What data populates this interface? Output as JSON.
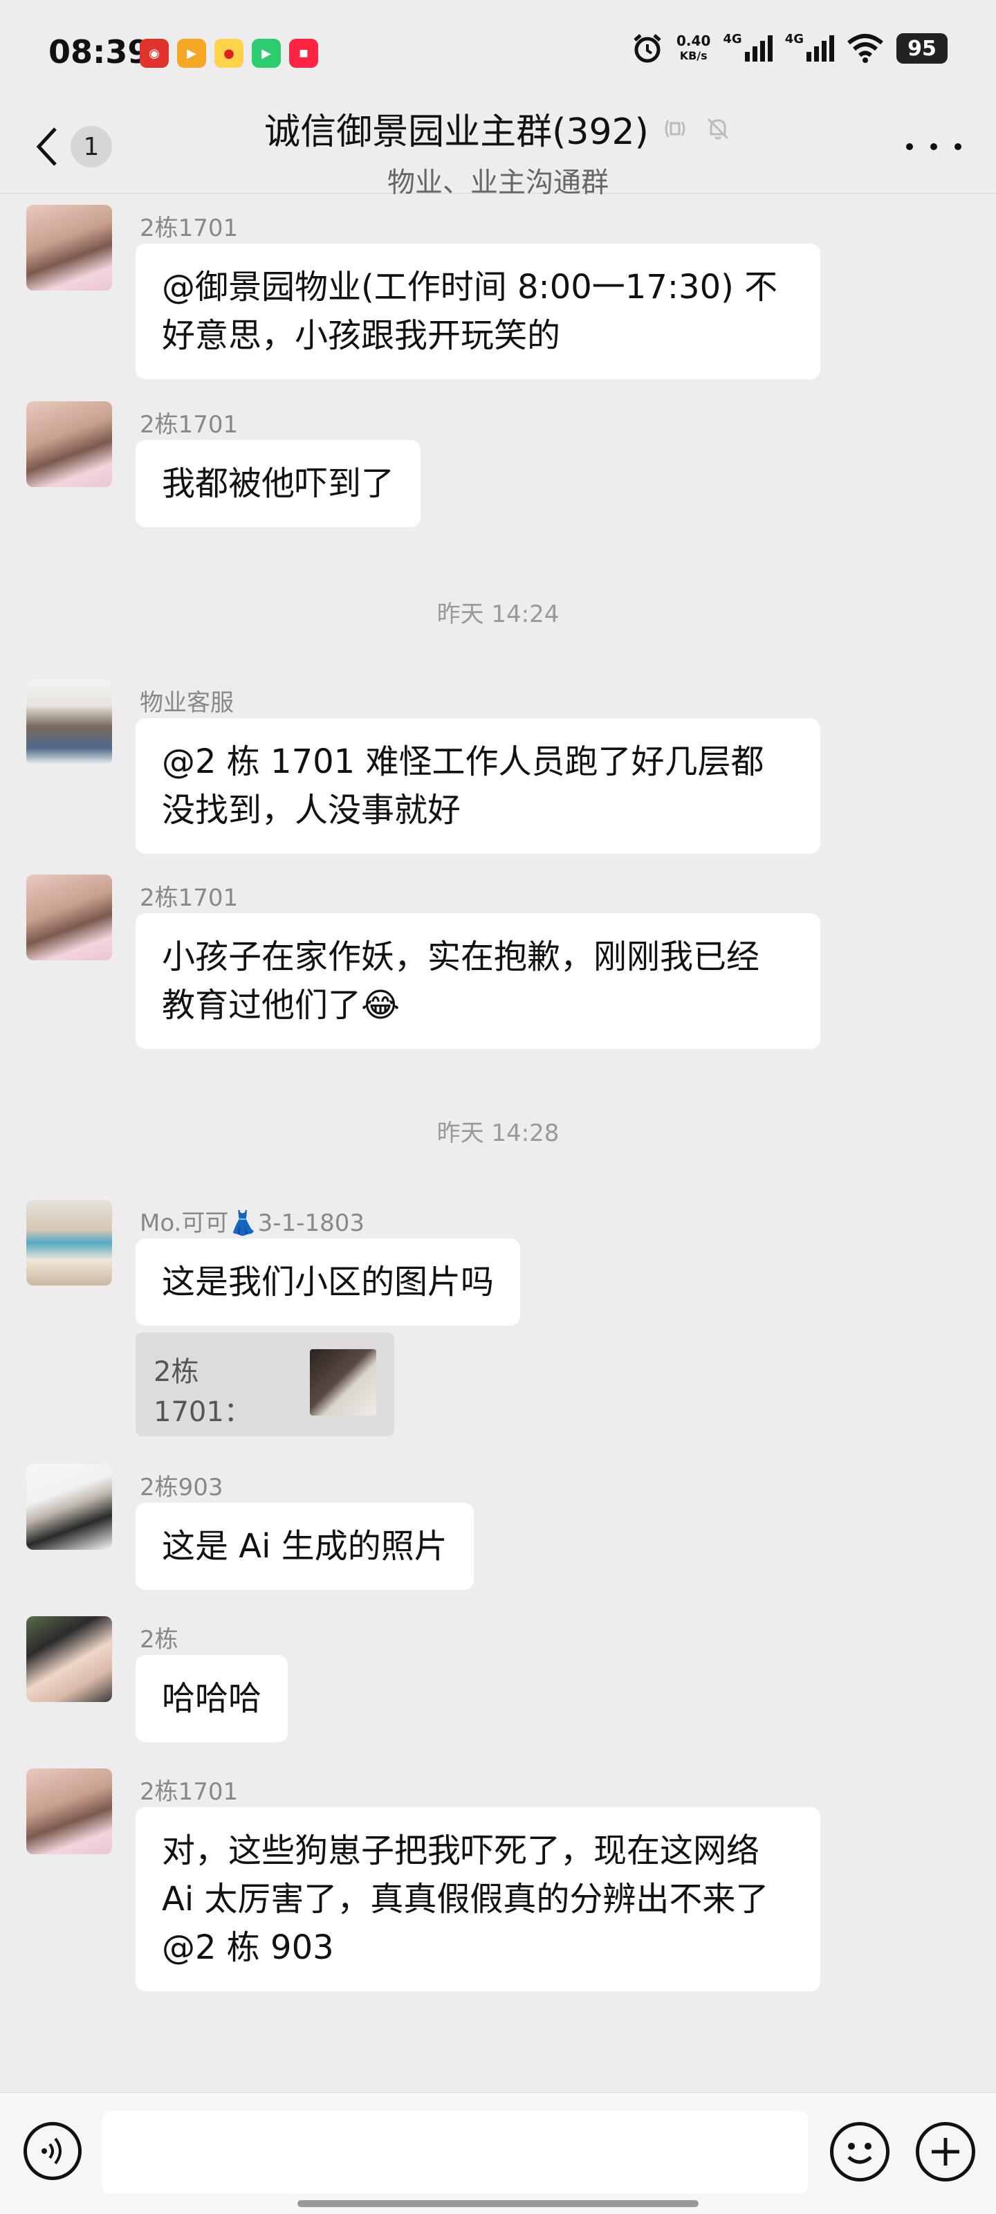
{
  "status_bar": {
    "time": "08:39",
    "net_speed_value": "0.40",
    "net_speed_unit": "KB/s",
    "signal_label": "4G",
    "battery": "95"
  },
  "header": {
    "back_count": "1",
    "title": "诚信御景园业主群(392)",
    "subtitle": "物业、业主沟通群"
  },
  "messages": [
    {
      "sender": "2栋1701",
      "lines": [
        "@御景园物业(工作时间 8:00一17:30) 不",
        "好意思，小孩跟我开玩笑的"
      ]
    },
    {
      "sender": "2栋1701",
      "lines": [
        "我都被他吓到了"
      ]
    },
    {
      "sender": "物业客服",
      "lines": [
        "@2 栋 1701  难怪工作人员跑了好几层都",
        "没找到，人没事就好"
      ]
    },
    {
      "sender": "2栋1701",
      "lines": [
        "小孩子在家作妖，实在抱歉，刚刚我已经",
        "教育过他们了😂"
      ]
    },
    {
      "sender": "Mo.可可👗3-1-1803",
      "lines": [
        "这是我们小区的图片吗"
      ],
      "quote": "2栋1701："
    },
    {
      "sender": "2栋903",
      "lines": [
        "这是 Ai 生成的照片"
      ]
    },
    {
      "sender": "2栋",
      "lines": [
        "哈哈哈"
      ]
    },
    {
      "sender": "2栋1701",
      "lines": [
        "对，这些狗崽子把我吓死了，现在这网络",
        "Ai 太厉害了，真真假假真的分辨出不来了",
        "@2 栋 903"
      ]
    }
  ],
  "timestamps": [
    "昨天 14:24",
    "昨天 14:28"
  ],
  "icons": {
    "back": "chevron-left-icon",
    "mute": "bell-off-icon",
    "more": "more-dots-icon",
    "voice": "voice-icon",
    "emoji": "emoji-icon",
    "plus": "plus-icon"
  }
}
